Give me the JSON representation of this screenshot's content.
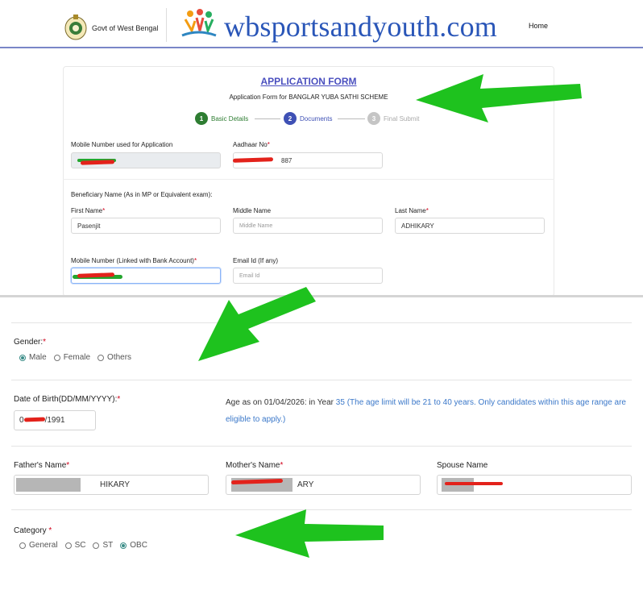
{
  "header": {
    "govt_label": "Govt of West Bengal",
    "site_name": "wbsportsandyouth.com",
    "home_link": "Home"
  },
  "form": {
    "title": "APPLICATION FORM",
    "subtitle": "Application Form for BANGLAR YUBA SATHI SCHEME",
    "steps": [
      {
        "num": "1",
        "label": "Basic Details",
        "color": "#2e7d32"
      },
      {
        "num": "2",
        "label": "Documents",
        "color": "#3f51b5"
      },
      {
        "num": "3",
        "label": "Final Submit",
        "color": "#c5c5c5"
      }
    ],
    "mobile_app_label": "Mobile Number used for Application",
    "aadhaar_label": "Aadhaar No",
    "aadhaar_value_suffix": "887",
    "beneficiary_label": "Beneficiary Name (As in MP or Equivalent exam):",
    "first_name_label": "First Name",
    "first_name_value": "Pasenjit",
    "middle_name_label": "Middle Name",
    "middle_name_placeholder": "Middle Name",
    "last_name_label": "Last Name",
    "last_name_value": "ADHIKARY",
    "mobile_bank_label": "Mobile Number (Linked with Bank Account)",
    "email_label": "Email Id (If any)",
    "email_placeholder": "Email Id"
  },
  "details": {
    "gender_label": "Gender:",
    "gender_options": [
      "Male",
      "Female",
      "Others"
    ],
    "gender_selected": "Male",
    "dob_label": "Date of Birth(DD/MM/YYYY):",
    "dob_value_prefix": "0",
    "dob_value_suffix": "/1991",
    "age_text_prefix": "Age as on 01/04/2026: in Year",
    "age_value": "35",
    "age_note": "(The age limit will be 21 to 40 years. Only candidates within this age range are eligible to apply.)",
    "father_label": "Father's Name",
    "father_value_suffix": "HIKARY",
    "mother_label": "Mother's Name",
    "mother_value_suffix": "ARY",
    "spouse_label": "Spouse Name",
    "category_label": "Category",
    "category_options": [
      "General",
      "SC",
      "ST",
      "OBC"
    ],
    "category_selected": "OBC"
  },
  "required_mark": "*",
  "colors": {
    "accent": "#4a4fbf",
    "radio": "#3a8c87",
    "age_note": "#3b78c9",
    "arrow": "#1ec21e",
    "redaction": "#e3221b"
  }
}
